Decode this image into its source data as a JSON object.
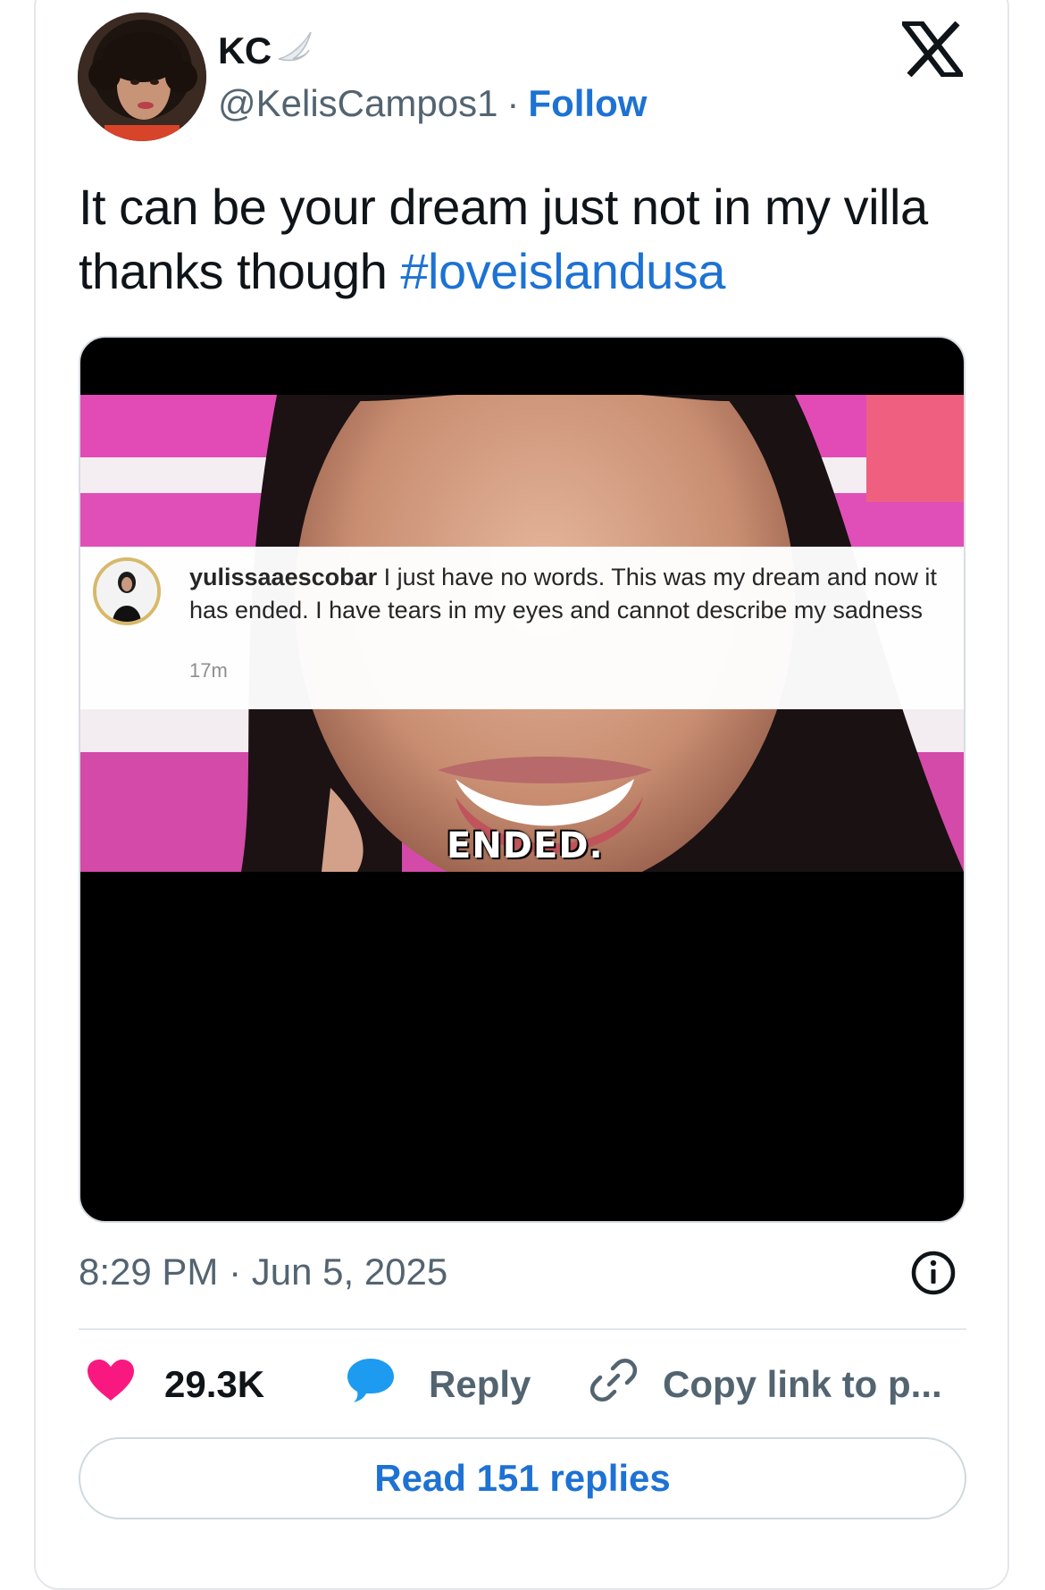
{
  "author": {
    "display_name": "KC",
    "handle": "@KelisCampos1",
    "separator": "·",
    "follow_label": "Follow"
  },
  "tweet": {
    "text": "It can be your dream just not in my villa thanks though ",
    "hashtag": "#loveislandusa"
  },
  "media": {
    "ig_username": "yulissaaescobar",
    "ig_comment": " I just have no words. This was my dream and now it has ended. I have tears in my eyes and cannot describe my sadness",
    "ig_time": "17m",
    "caption": "ENDED."
  },
  "meta": {
    "timestamp": "8:29 PM · Jun 5, 2025"
  },
  "actions": {
    "likes": "29.3K",
    "reply_label": "Reply",
    "copy_link_label": "Copy link to p..."
  },
  "read_replies_label": "Read 151 replies",
  "colors": {
    "link_blue": "#1d72d3",
    "like_pink": "#f91880",
    "reply_blue": "#1d9bf0",
    "secondary_text": "#536471"
  },
  "icons": [
    "x-logo-icon",
    "wing-icon",
    "info-icon",
    "heart-icon",
    "speech-bubble-icon",
    "link-icon"
  ]
}
